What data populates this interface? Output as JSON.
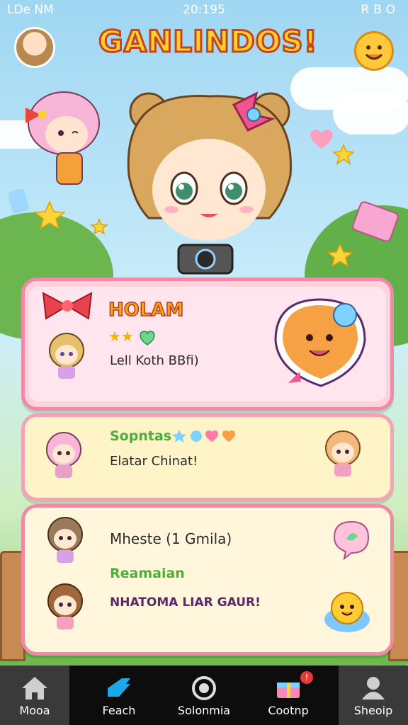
{
  "status_bar": {
    "left": "LDe NM",
    "time": "20:195",
    "right": "RBO"
  },
  "app": {
    "title": "GANLINDOS!"
  },
  "cards": [
    {
      "name": "HOLAM",
      "stars": "★★",
      "subtitle": "Lell Koth BBfi)"
    },
    {
      "name": "Sopntas",
      "subtitle": "Elatar Chinat!"
    },
    {
      "line1": "Mheste (1 Gmila)",
      "name": "Reamaian",
      "line2": "NHATOMA LIAR GAUR!"
    }
  ],
  "tabs": [
    {
      "label": "Mooa",
      "icon": "home-icon",
      "active": true
    },
    {
      "label": "Feach",
      "icon": "search-icon",
      "active": false
    },
    {
      "label": "Solonmia",
      "icon": "camera-icon",
      "active": false
    },
    {
      "label": "Cootnp",
      "icon": "gift-box-icon",
      "active": false,
      "badge": "!"
    },
    {
      "label": "Sheoip",
      "icon": "profile-icon",
      "active": true
    }
  ],
  "colors": {
    "accent": "#ffcf2e",
    "title_stroke": "#c5451f",
    "card_border": "#f08aa8",
    "tabbar": "#0d0d0d"
  }
}
